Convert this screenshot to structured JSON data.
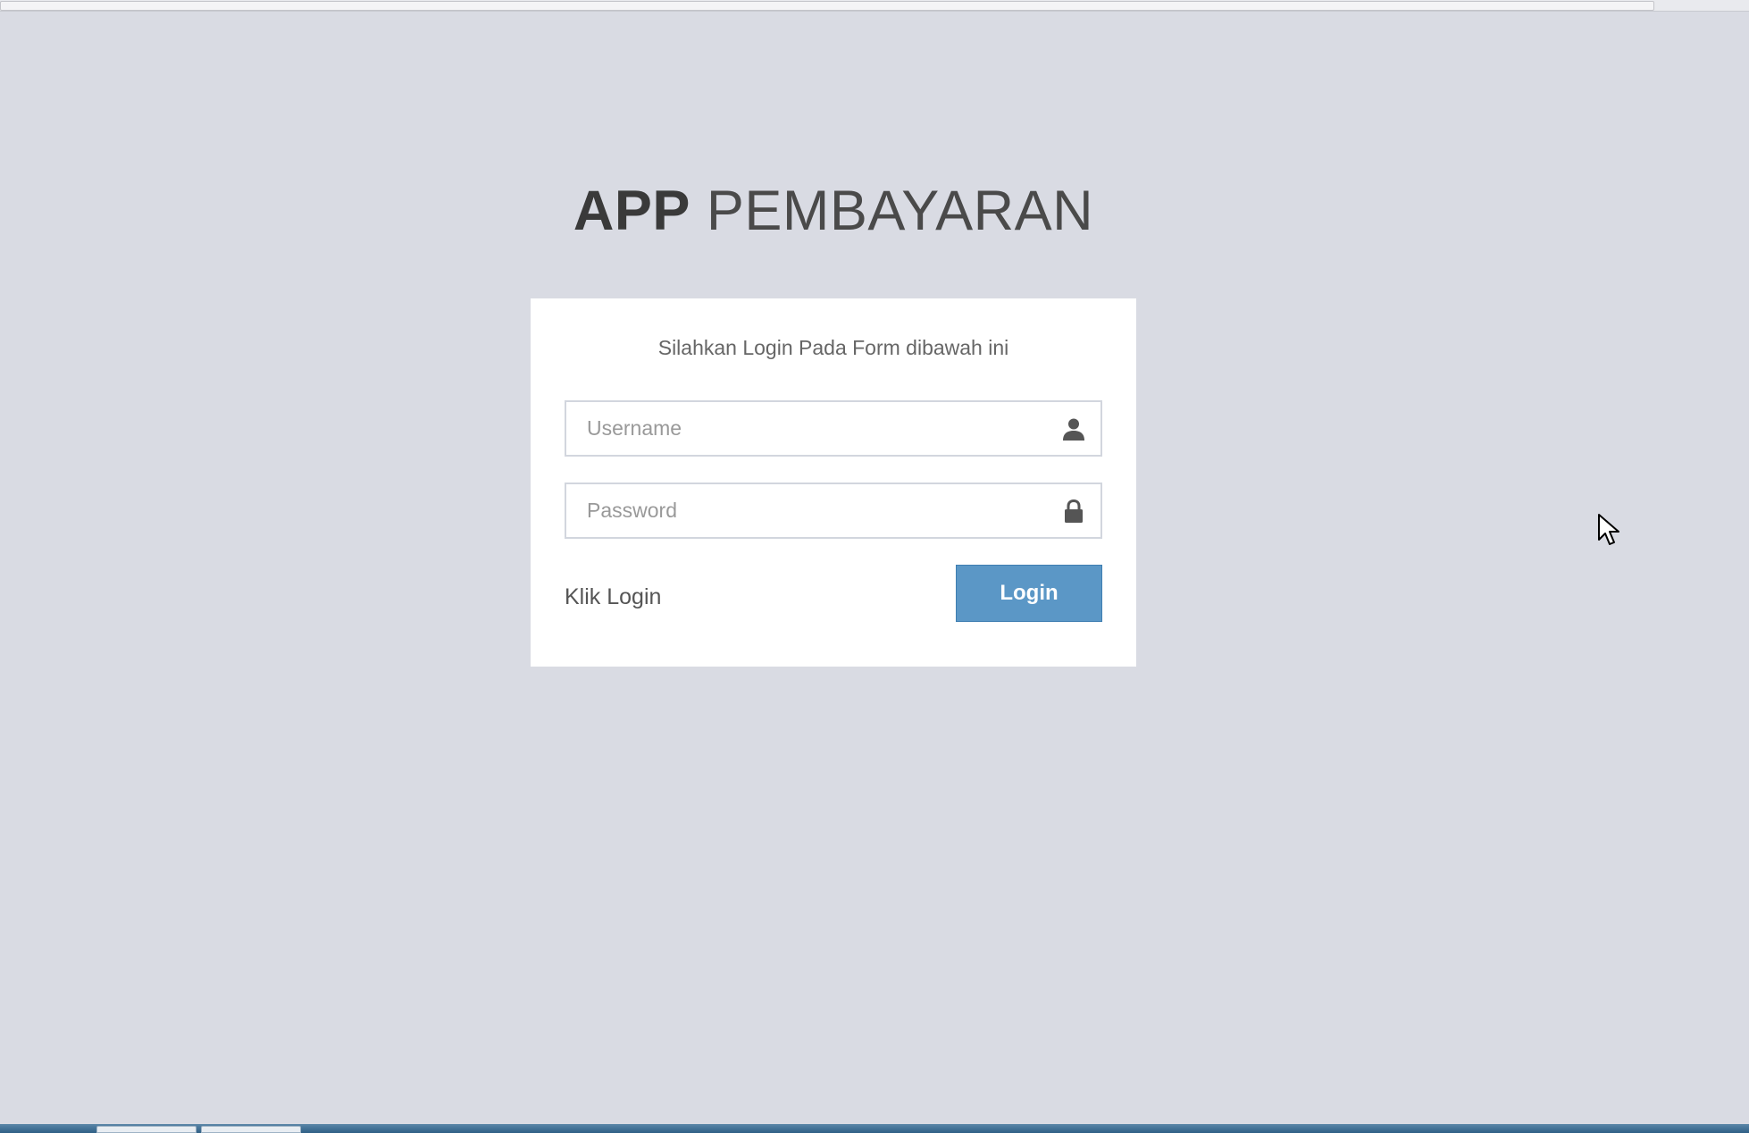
{
  "header": {
    "title_bold": "APP",
    "title_light": "PEMBAYARAN"
  },
  "login": {
    "message": "Silahkan Login Pada Form dibawah ini",
    "username": {
      "placeholder": "Username",
      "value": "",
      "icon": "user-icon"
    },
    "password": {
      "placeholder": "Password",
      "value": "",
      "icon": "lock-icon"
    },
    "hint_text": "Klik Login",
    "submit_label": "Login"
  },
  "colors": {
    "background": "#d9dbe3",
    "button": "#5b97c6",
    "box": "#ffffff"
  }
}
